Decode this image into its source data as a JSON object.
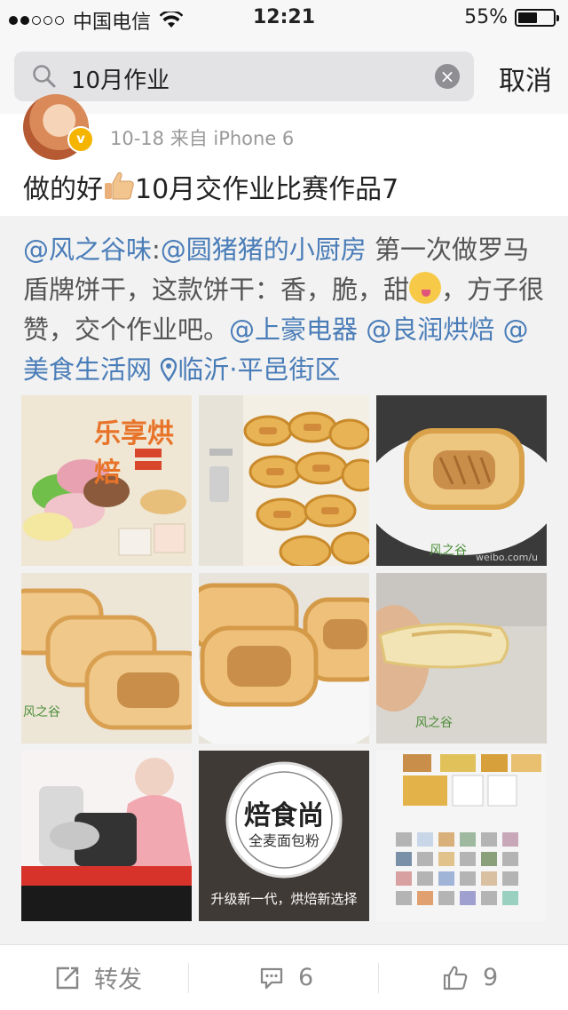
{
  "status_bar": {
    "carrier": "中国电信",
    "time": "12:21",
    "battery": "55%",
    "battery_level": 0.55
  },
  "search": {
    "query": "10月作业",
    "cancel_label": "取消"
  },
  "post": {
    "meta": "10-18  来自 iPhone 6",
    "text_before": "做的好",
    "text_after": "10月交作业比赛作品7"
  },
  "retweet": {
    "author": "@风之谷味",
    "colon": ":",
    "mention1": "@圆猪猪的小厨房",
    "body1": " 第一次做罗马盾牌饼干，这款饼干：香，脆，甜",
    "body2": "，方子很赞，交个作业吧。",
    "mention2": "@上豪电器",
    "mention3": "@良润烘焙",
    "mention4": "@美食生活网",
    "location": "临沂·平邑街区"
  },
  "images": {
    "cap1": "乐享烘焙",
    "cap3": "风之谷",
    "cap3b": "weibo.com/u",
    "cap4": "风之谷",
    "cap6": "风之谷",
    "cap8_title": "焙食尚",
    "cap8_sub": "全麦面包粉",
    "cap8_slogan": "升级新一代，烘焙新选择"
  },
  "actions": {
    "repost_label": "转发",
    "comment_count": "6",
    "like_count": "9"
  },
  "icons": [
    "search-icon",
    "clear-icon",
    "repost-icon",
    "comment-icon",
    "like-icon",
    "location-icon",
    "thumbs-up-emoji",
    "tongue-emoji",
    "verified-badge-icon"
  ],
  "colors": {
    "link": "#4a7db8",
    "badge": "#f4b400"
  }
}
